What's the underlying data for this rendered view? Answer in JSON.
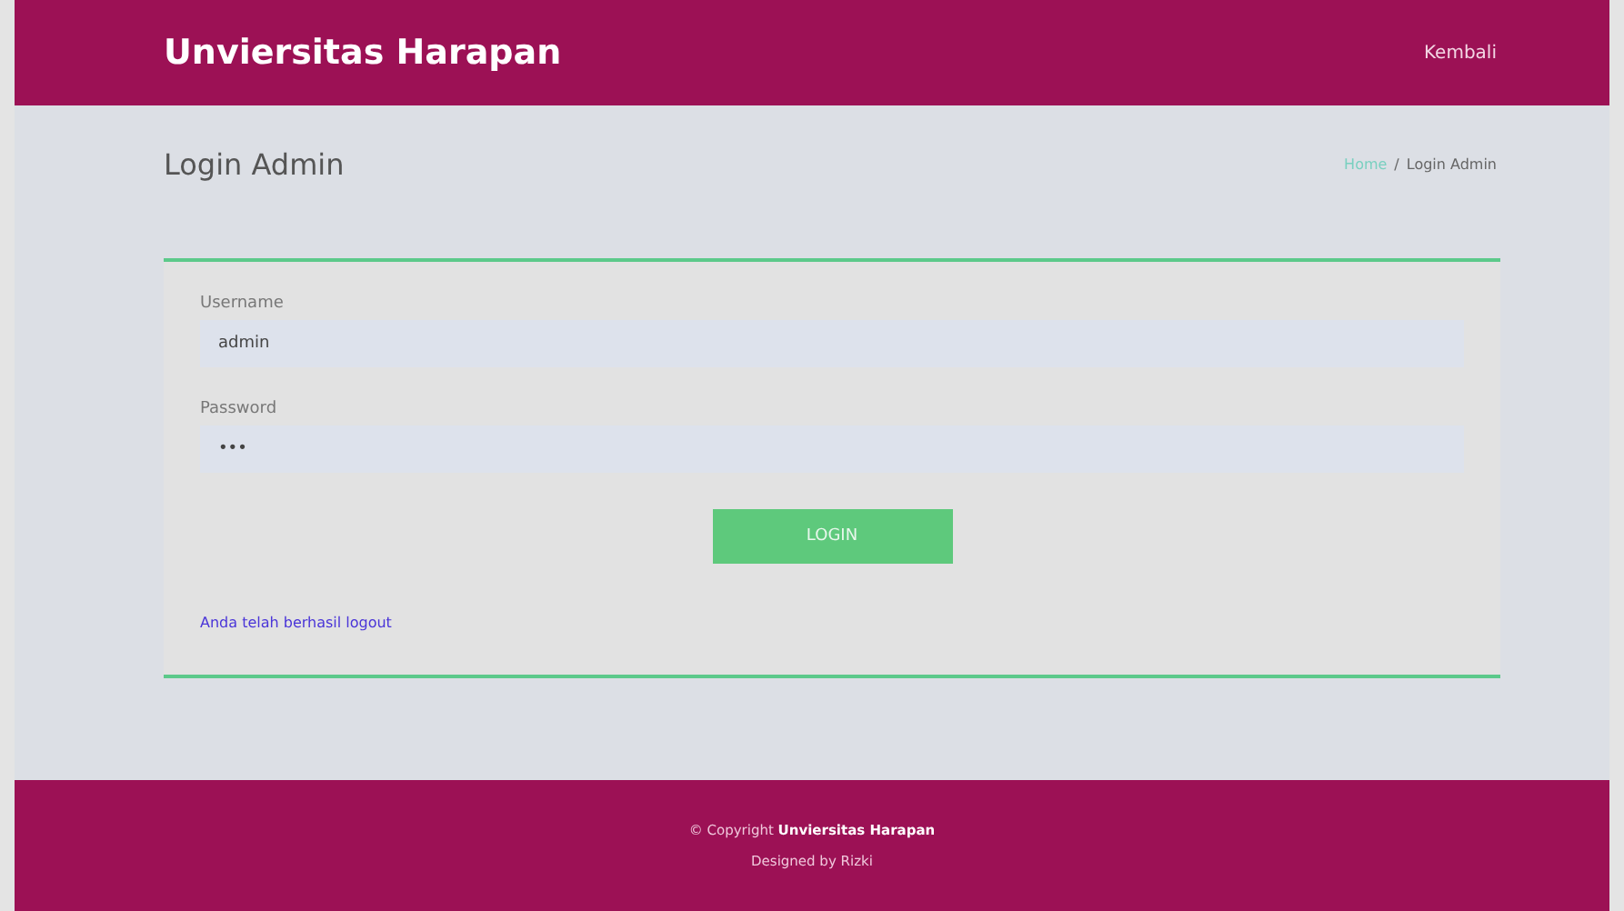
{
  "header": {
    "brand": "Unviersitas Harapan",
    "nav_link": "Kembali"
  },
  "page_title": "Login Admin",
  "breadcrumb": [
    {
      "label": "Home",
      "kind": "link"
    },
    {
      "label": "/",
      "kind": "separator"
    },
    {
      "label": "Login Admin",
      "kind": "current"
    }
  ],
  "form": {
    "fields": [
      {
        "label": "Username",
        "value": "admin"
      },
      {
        "label": "Password",
        "value": "•••"
      }
    ],
    "submit": "LOGIN",
    "message": "Anda telah berhasil logout"
  },
  "footer": {
    "copyright_prefix": "© Copyright",
    "copyright_name": "Unviersitas Harapan",
    "credit_prefix": "Designed by",
    "credit_name": "Rizki"
  }
}
